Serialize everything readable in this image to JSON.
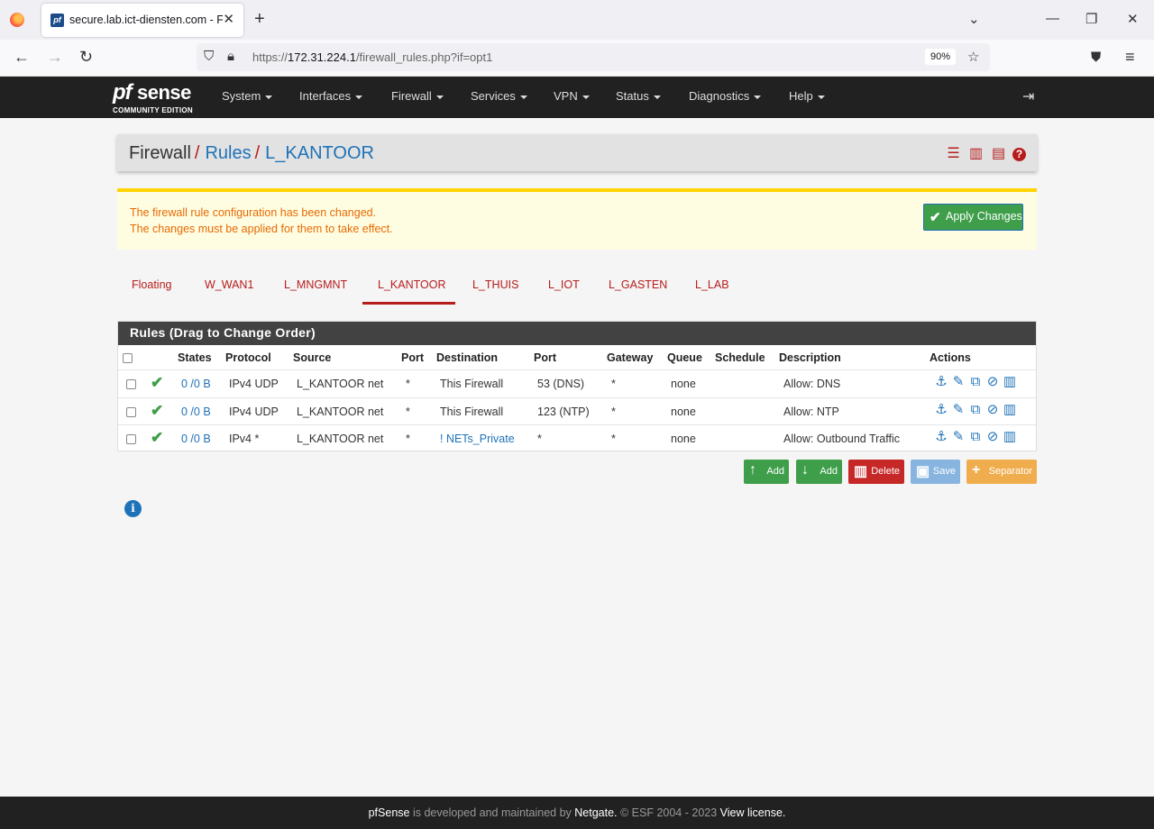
{
  "browser": {
    "tab_title": "secure.lab.ict-diensten.com - Fi",
    "url_prefix": "https://",
    "url_host": "172.31.224.1",
    "url_path": "/firewall_rules.php?if=opt1",
    "zoom": "90%"
  },
  "brand": {
    "logo_pf": "pf",
    "logo_sense": "sense",
    "subtitle": "COMMUNITY EDITION"
  },
  "menu": [
    "System",
    "Interfaces",
    "Firewall",
    "Services",
    "VPN",
    "Status",
    "Diagnostics",
    "Help"
  ],
  "breadcrumb": {
    "first": "Firewall",
    "second": "Rules",
    "third": "L_KANTOOR",
    "sep": "/"
  },
  "alert": {
    "line1": "The firewall rule configuration has been changed.",
    "line2": "The changes must be applied for them to take effect.",
    "apply_label": "Apply Changes"
  },
  "tabs": [
    "Floating",
    "W_WAN1",
    "L_MNGMNT",
    "L_KANTOOR",
    "L_THUIS",
    "L_IOT",
    "L_GASTEN",
    "L_LAB"
  ],
  "active_tab": "L_KANTOOR",
  "panel_title": "Rules (Drag to Change Order)",
  "columns": [
    "States",
    "Protocol",
    "Source",
    "Port",
    "Destination",
    "Port",
    "Gateway",
    "Queue",
    "Schedule",
    "Description",
    "Actions"
  ],
  "rules": [
    {
      "states": "0 /0 B",
      "protocol": "IPv4 UDP",
      "source": "L_KANTOOR net",
      "src_port": "*",
      "destination": "This Firewall",
      "dst_port": "53 (DNS)",
      "gateway": "*",
      "queue": "none",
      "schedule": "",
      "description": "Allow: DNS"
    },
    {
      "states": "0 /0 B",
      "protocol": "IPv4 UDP",
      "source": "L_KANTOOR net",
      "src_port": "*",
      "destination": "This Firewall",
      "dst_port": "123 (NTP)",
      "gateway": "*",
      "queue": "none",
      "schedule": "",
      "description": "Allow: NTP"
    },
    {
      "states": "0 /0 B",
      "protocol": "IPv4 *",
      "source": "L_KANTOOR net",
      "src_port": "*",
      "destination": "! NETs_Private",
      "dst_port": "*",
      "gateway": "*",
      "queue": "none",
      "schedule": "",
      "description": "Allow: Outbound Traffic"
    }
  ],
  "buttons": {
    "add_top": "Add",
    "add_bottom": "Add",
    "delete": "Delete",
    "save": "Save",
    "separator": "Separator"
  },
  "footer": {
    "brand": "pfSense",
    "text1": " is developed and maintained by ",
    "company": "Netgate.",
    "text2": " © ESF 2004 - 2023 ",
    "license": "View license."
  },
  "colors": {
    "accent_red": "#b71c1c",
    "link_blue": "#1e72b8",
    "success_green": "#3e9e4a",
    "warning_orange": "#f0ad4e"
  }
}
